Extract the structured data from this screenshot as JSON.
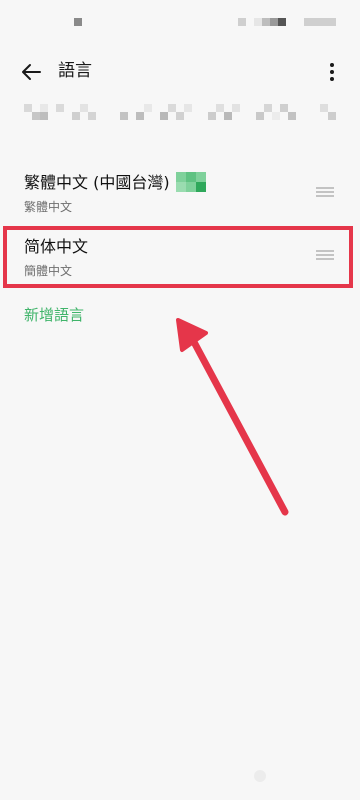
{
  "app_bar": {
    "title": "語言",
    "back_icon": "arrow-left-icon",
    "more_icon": "more-vertical-icon"
  },
  "languages": [
    {
      "name": "繁體中文 (中國台灣)",
      "native": "繁體中文",
      "flag_color": "#3fb46a"
    },
    {
      "name": "简体中文",
      "native": "簡體中文"
    }
  ],
  "add_language_label": "新增語言",
  "colors": {
    "accent": "#3fb46a",
    "highlight": "#e5364a",
    "background": "#f7f7f7"
  }
}
